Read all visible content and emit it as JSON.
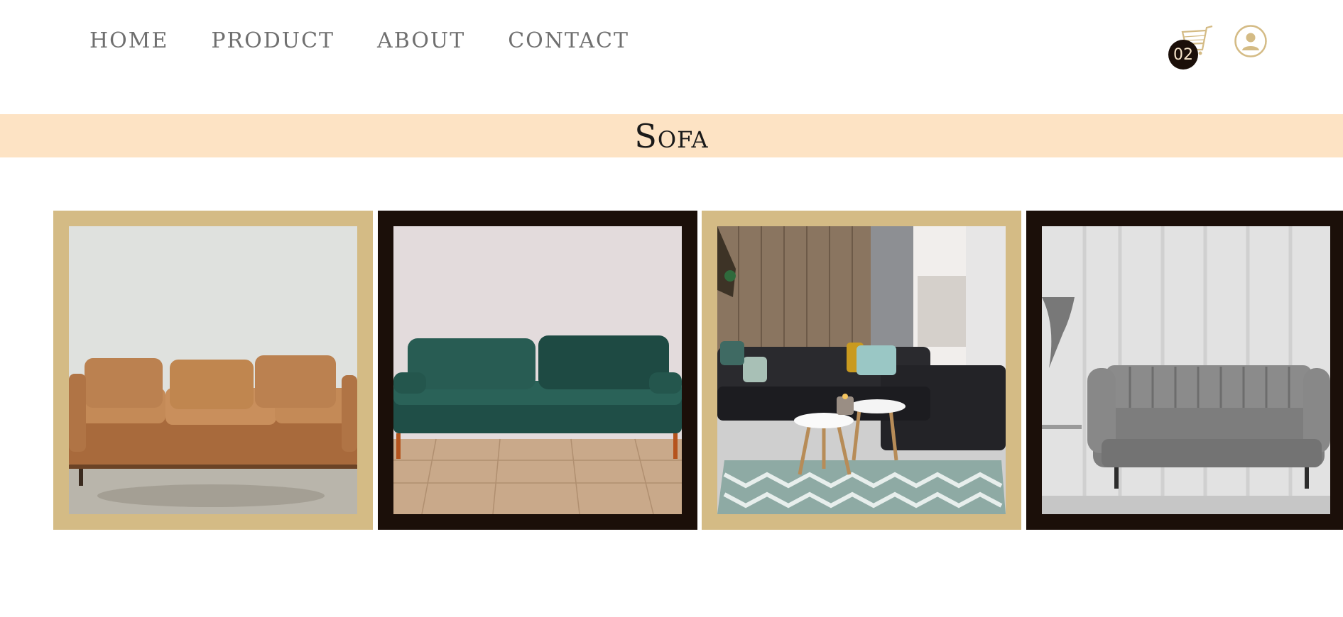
{
  "nav": {
    "items": [
      "HOME",
      "PRODUCT",
      "ABOUT",
      "CONTACT"
    ]
  },
  "header": {
    "cart_count": "02",
    "cart_icon": "cart-icon",
    "user_icon": "user-circle-icon"
  },
  "banner": {
    "title": "Sofa"
  },
  "gallery": {
    "cards": [
      {
        "frame": "tan",
        "subject": "tan leather three-seat sofa"
      },
      {
        "frame": "dark",
        "subject": "green velvet sofa"
      },
      {
        "frame": "tan",
        "subject": "dark sectional sofa with coffee tables"
      },
      {
        "frame": "dark",
        "subject": "grey channel-tufted loveseat"
      }
    ]
  },
  "colors": {
    "accent_gold": "#d4bb85",
    "dark_brown": "#1b0f09",
    "banner_peach": "#fde3c4",
    "nav_text": "#6f6f6f"
  }
}
